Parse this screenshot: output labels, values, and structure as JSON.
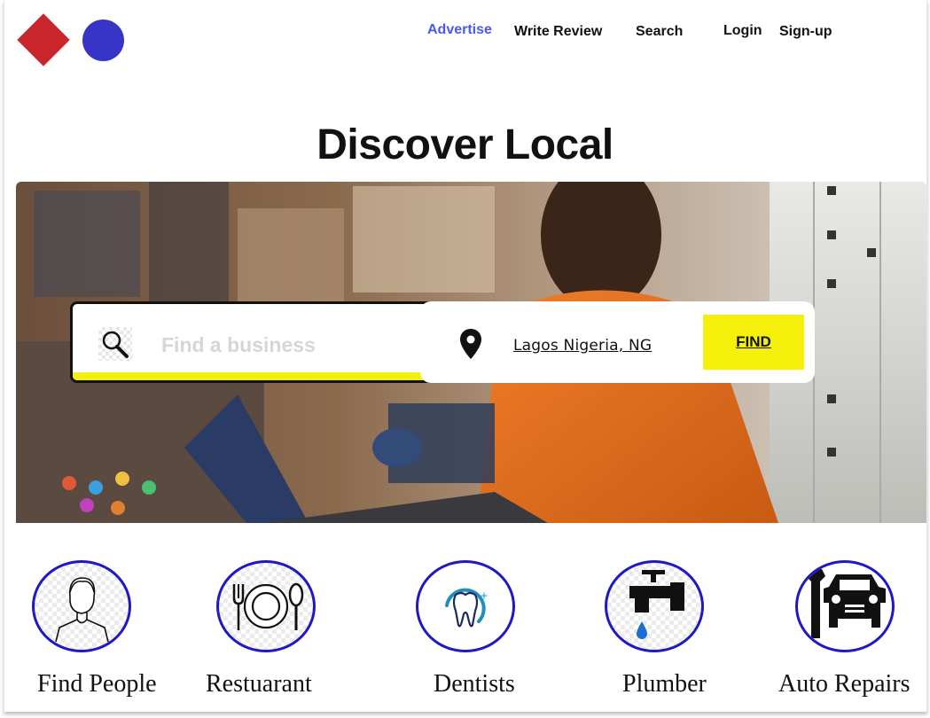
{
  "nav": {
    "advertise": "Advertise",
    "write_review": "Write Review",
    "search": "Search",
    "login": "Login",
    "signup": "Sign-up"
  },
  "hero": {
    "title": "Discover Local"
  },
  "search": {
    "placeholder": "Find a business",
    "location": "Lagos Nigeria, NG",
    "find_label": "FIND"
  },
  "categories": [
    {
      "label": "Find People",
      "icon": "person-icon"
    },
    {
      "label": "Restuarant",
      "icon": "plate-cutlery-icon"
    },
    {
      "label": "Dentists",
      "icon": "tooth-icon"
    },
    {
      "label": "Plumber",
      "icon": "faucet-icon"
    },
    {
      "label": "Auto Repairs",
      "icon": "car-wrench-icon"
    }
  ],
  "colors": {
    "accent_yellow": "#f5f00a",
    "brand_blue": "#3734c8",
    "brand_red": "#c9262c",
    "nav_link_blue": "#4a57f0",
    "category_ring": "#1e18c6"
  }
}
